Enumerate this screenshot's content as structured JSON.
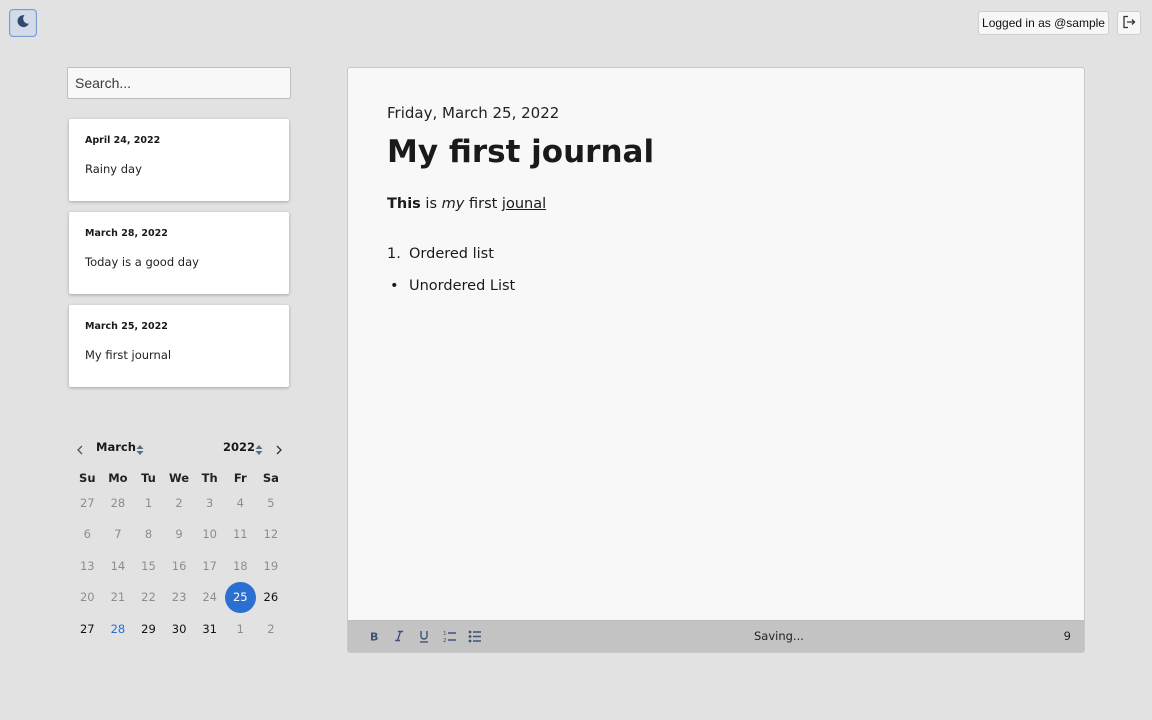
{
  "header": {
    "theme_icon": "moon-icon",
    "login_text": "Logged in as @sample",
    "logout_icon": "logout-icon"
  },
  "search": {
    "placeholder": "Search..."
  },
  "entries": [
    {
      "date": "April 24, 2022",
      "title": "Rainy day"
    },
    {
      "date": "March 28, 2022",
      "title": "Today is a good day"
    },
    {
      "date": "March 25, 2022",
      "title": "My first journal"
    }
  ],
  "calendar": {
    "month": "March",
    "year": "2022",
    "weekdays": [
      "Su",
      "Mo",
      "Tu",
      "We",
      "Th",
      "Fr",
      "Sa"
    ],
    "days": [
      [
        "27",
        "28",
        "1",
        "2",
        "3",
        "4",
        "5"
      ],
      [
        "6",
        "7",
        "8",
        "9",
        "10",
        "11",
        "12"
      ],
      [
        "13",
        "14",
        "15",
        "16",
        "17",
        "18",
        "19"
      ],
      [
        "20",
        "21",
        "22",
        "23",
        "24",
        "25",
        "26"
      ],
      [
        "27",
        "28",
        "29",
        "30",
        "31",
        "1",
        "2"
      ]
    ],
    "selected_day": "25",
    "today_day": "28",
    "accent_color": "#2b6fd1"
  },
  "editor": {
    "date": "Friday, March 25, 2022",
    "title": "My first journal",
    "paragraph": {
      "bold": "This",
      "plain1": " is ",
      "italic": "my",
      "plain2": " first ",
      "underline": "jounal"
    },
    "ordered_item_number": "1.",
    "ordered_item": "Ordered list",
    "unordered_bullet": "•",
    "unordered_item": "Unordered List"
  },
  "toolbar": {
    "bold_icon": "bold-icon",
    "italic_icon": "italic-icon",
    "underline_icon": "underline-icon",
    "ordered_list_icon": "ordered-list-icon",
    "unordered_list_icon": "unordered-list-icon",
    "status": "Saving...",
    "count": "9"
  }
}
